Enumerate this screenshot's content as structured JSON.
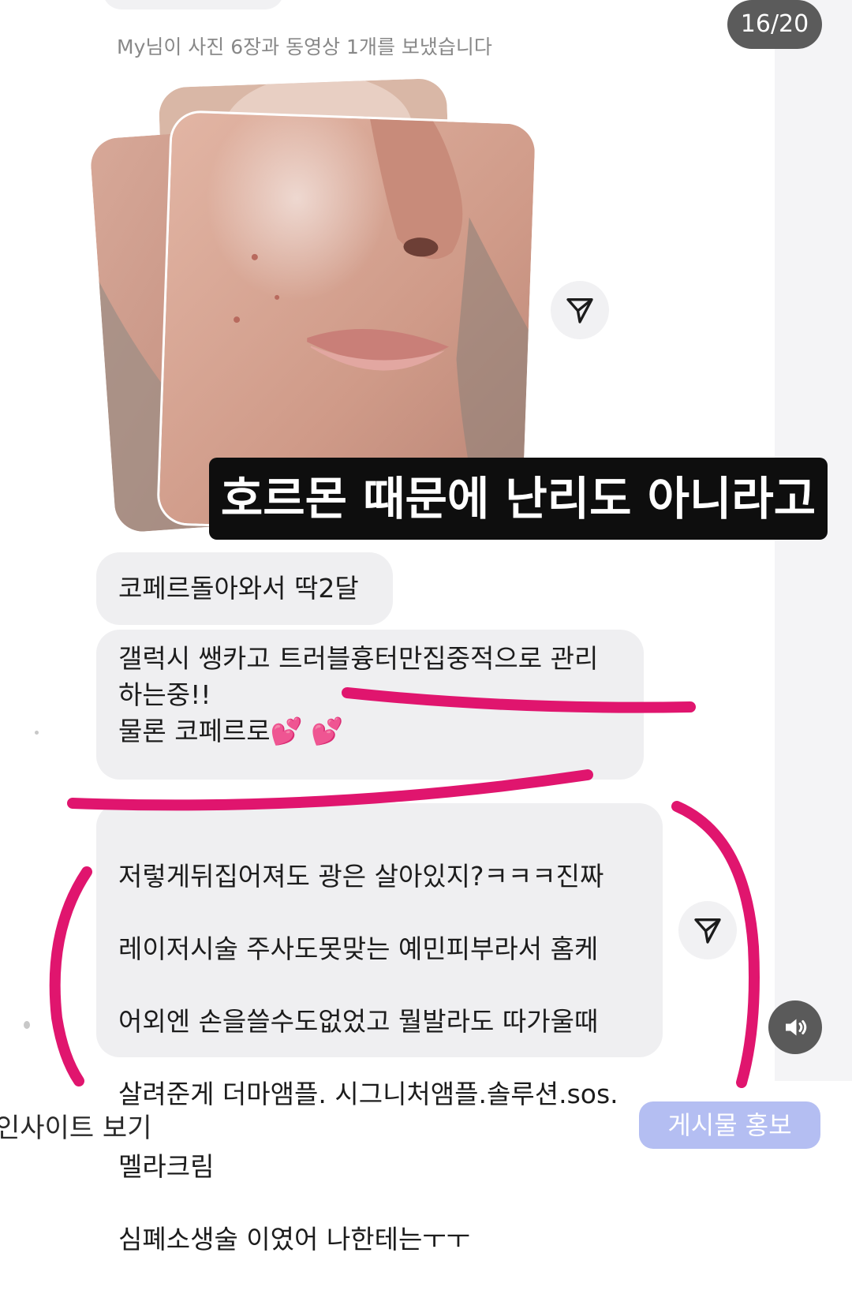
{
  "story": {
    "counter": "16/20",
    "overlay_caption": "호르몬 때문에 난리도 아니라고"
  },
  "chat": {
    "sent_notice": "My님이 사진 6장과 동영상 1개를 보냈습니다",
    "messages": [
      {
        "text": "코페르돌아와서 딱2달"
      },
      {
        "text": "갤럭시 쌩카고 트러블흉터만집중적으로 관리\n하는중!!\n물론 코페르로💕 💕"
      },
      {
        "lines": [
          "저렇게뒤집어져도 광은 살아있지?ㅋㅋㅋ진짜",
          "레이저시술 주사도못맞는 예민피부라서 홈케",
          "어외엔 손을쓸수도없었고 뭘발라도 따가울때",
          "살려준게 더마앰플. 시그니처앰플.솔루션.sos.",
          "멜라크림",
          "심폐소생술 이였어 나한테는ㅜㅜ"
        ]
      }
    ]
  },
  "footer": {
    "left_link": "인사이트 보기",
    "promote_button": "게시물 홍보"
  },
  "colors": {
    "annotation": "#e0156e",
    "counter_bg": "#5b5b5b",
    "bubble_bg": "#efeff1",
    "promote_bg": "#b4bef2"
  },
  "icons": [
    "send-icon",
    "volume-icon"
  ]
}
